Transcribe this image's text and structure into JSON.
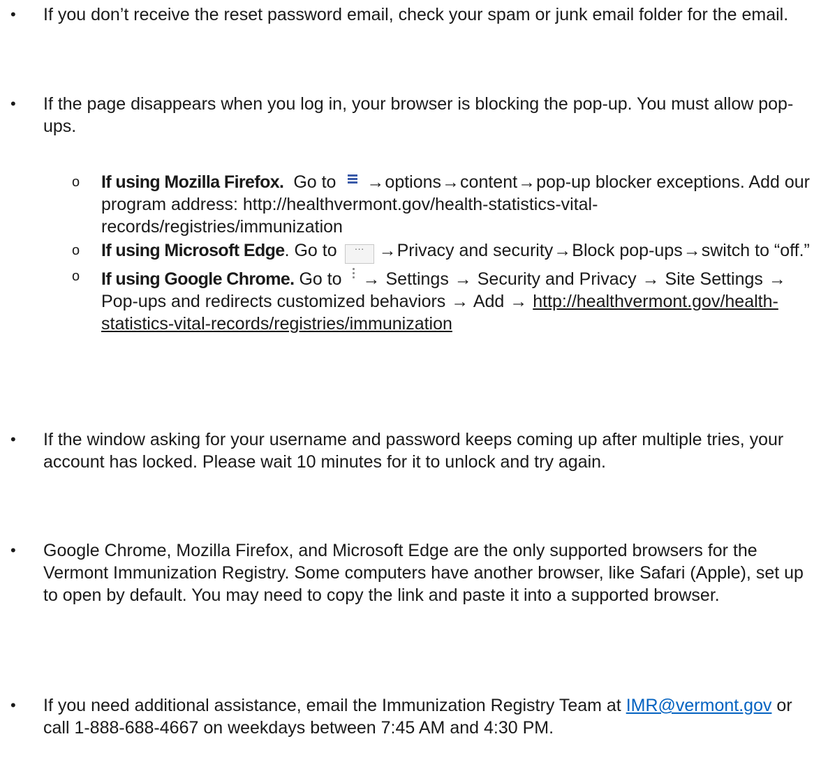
{
  "bullets": {
    "spam": "If you don’t receive the reset password email, check your spam or junk email folder for the email.",
    "popup_intro": "If the page disappears when you log in, your browser is blocking the pop-up. You must allow pop-ups.",
    "firefox": {
      "label": "If using Mozilla Firefox.",
      "go_to": "Go to",
      "icon": "hamburger-menu-icon",
      "step1": "options",
      "step2": "content",
      "step3": "pop-up blocker exceptions. Add our program address: http://healthvermont.gov/health-statistics-vital-records/registries/immunization"
    },
    "edge": {
      "label": "If using Microsoft Edge",
      "go_to": ". Go to",
      "icon": "ellipsis-button-icon",
      "icon_text": "···",
      "step1": "Privacy and security",
      "step2": "Block pop-ups",
      "step3": "switch to “off.”"
    },
    "chrome": {
      "label": "If using Google Chrome.",
      "go_to": "Go to",
      "icon": "vertical-dots-icon",
      "step1": "Settings",
      "step2": "Security and Privacy",
      "step3": "Site Settings",
      "step4": "Pop-ups and redirects customized behaviors",
      "step5": "Add",
      "link": "http://healthvermont.gov/health-statistics-vital-records/registries/immunization"
    },
    "locked": "If the window asking for your username and password keeps coming up after multiple tries, your account has locked. Please wait 10 minutes for it to unlock and try again.",
    "browsers": "Google Chrome, Mozilla Firefox, and Microsoft Edge are the only supported browsers for the Vermont Immunization Registry. Some computers have another browser, like Safari (Apple), set up to open by default. You may need to copy the link and paste it into a supported browser.",
    "assist": {
      "before": "If you need additional assistance, email the Immunization Registry Team at",
      "email": "IMR@vermont.gov",
      "after": "or call 1-888-688-4667 on weekdays between 7:45 AM and 4:30 PM."
    }
  },
  "symbols": {
    "bullet": "•",
    "sub_bullet": "o",
    "arrow": "→"
  }
}
